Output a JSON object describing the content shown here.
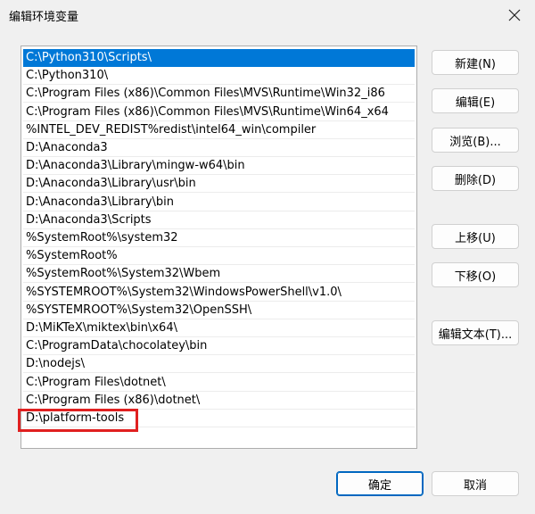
{
  "window": {
    "title": "编辑环境变量",
    "close_icon": "close-icon"
  },
  "paths": [
    "C:\\Python310\\Scripts\\",
    "C:\\Python310\\",
    "C:\\Program Files (x86)\\Common Files\\MVS\\Runtime\\Win32_i86",
    "C:\\Program Files (x86)\\Common Files\\MVS\\Runtime\\Win64_x64",
    "%INTEL_DEV_REDIST%redist\\intel64_win\\compiler",
    "D:\\Anaconda3",
    "D:\\Anaconda3\\Library\\mingw-w64\\bin",
    "D:\\Anaconda3\\Library\\usr\\bin",
    "D:\\Anaconda3\\Library\\bin",
    "D:\\Anaconda3\\Scripts",
    "%SystemRoot%\\system32",
    "%SystemRoot%",
    "%SystemRoot%\\System32\\Wbem",
    "%SYSTEMROOT%\\System32\\WindowsPowerShell\\v1.0\\",
    "%SYSTEMROOT%\\System32\\OpenSSH\\",
    "D:\\MiKTeX\\miktex\\bin\\x64\\",
    "C:\\ProgramData\\chocolatey\\bin",
    "D:\\nodejs\\",
    "C:\\Program Files\\dotnet\\",
    "C:\\Program Files (x86)\\dotnet\\",
    "D:\\platform-tools"
  ],
  "selected_index": 0,
  "highlighted_index": 20,
  "buttons": {
    "new": "新建(N)",
    "edit": "编辑(E)",
    "browse": "浏览(B)...",
    "delete": "删除(D)",
    "move_up": "上移(U)",
    "move_down": "下移(O)",
    "edit_text": "编辑文本(T)...",
    "ok": "确定",
    "cancel": "取消"
  },
  "colors": {
    "selection": "#0078d7",
    "highlight_box": "#e02020"
  }
}
